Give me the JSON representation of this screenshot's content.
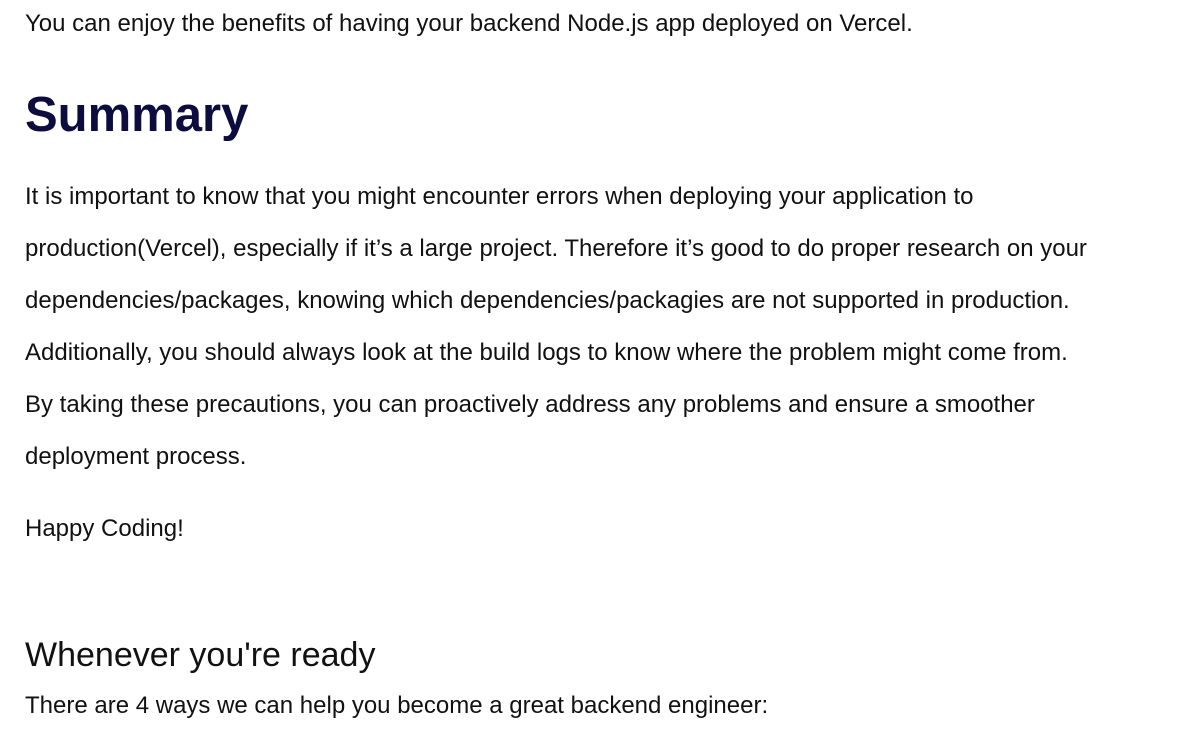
{
  "intro": {
    "text": "You can enjoy the benefits of having your backend Node.js app deployed on Vercel."
  },
  "summary": {
    "heading": "Summary",
    "lines": [
      "It is important to know that you might encounter errors when deploying your application to",
      "production(Vercel), especially if it’s a large project. Therefore it’s good to do proper research on your",
      "dependencies/packages, knowing which dependencies/packagies are not supported in production.",
      "Additionally, you should always look at the build logs to know where the problem might come from.",
      "By taking these precautions, you can proactively address any problems and ensure a smoother",
      "deployment process."
    ],
    "signoff": "Happy Coding!"
  },
  "cta": {
    "heading": "Whenever you're ready",
    "text": "There are 4 ways we can help you become a great backend engineer:"
  },
  "colors": {
    "heading": "#0d0c3f",
    "text": "#111111",
    "background": "#ffffff"
  }
}
